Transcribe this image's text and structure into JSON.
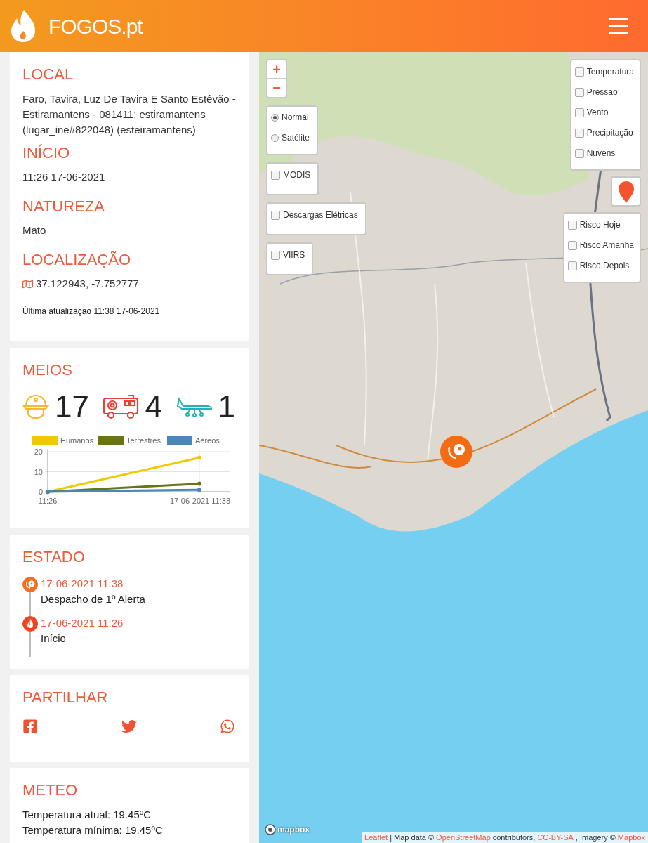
{
  "header": {
    "logo": "FOGOS.pt"
  },
  "sections": {
    "local": {
      "title": "LOCAL",
      "text": "Faro, Tavira, Luz De Tavira E Santo Estêvão - Estiramantens - 081411: estiramantens (lugar_ine#822048) (esteiramantens)"
    },
    "inicio": {
      "title": "INÍCIO",
      "text": "11:26 17-06-2021"
    },
    "natureza": {
      "title": "NATUREZA",
      "text": "Mato"
    },
    "localizacao": {
      "title": "LOCALIZAÇÃO",
      "coords": "37.122943, -7.752777"
    },
    "updated": "Última atualização 11:38 17-06-2021"
  },
  "meios": {
    "title": "MEIOS",
    "counts": [
      {
        "kind": "human",
        "value": "17",
        "color": "#f5b82e"
      },
      {
        "kind": "ground",
        "value": "4",
        "color": "#e8403a"
      },
      {
        "kind": "air",
        "value": "1",
        "color": "#1fb3b3"
      }
    ],
    "chart_data": {
      "type": "line",
      "legend": "top",
      "categories": [
        "11:26",
        "17-06-2021 11:38"
      ],
      "ylim": [
        0,
        20
      ],
      "yticks": [
        0,
        10,
        20
      ],
      "series": [
        {
          "name": "Humanos",
          "color": "#f0c800",
          "marker": "circle",
          "values": [
            0,
            17
          ]
        },
        {
          "name": "Terrestres",
          "color": "#6b7414",
          "marker": "circle",
          "values": [
            0,
            4
          ]
        },
        {
          "name": "Aéreos",
          "color": "#4a86b8",
          "marker": "circle",
          "values": [
            0,
            1
          ]
        }
      ]
    }
  },
  "estado": {
    "title": "ESTADO",
    "events": [
      {
        "kind": "dispatch",
        "date": "17-06-2021 11:38",
        "label": "Despacho de 1º Alerta"
      },
      {
        "kind": "start",
        "date": "17-06-2021 11:26",
        "label": "Início"
      }
    ]
  },
  "partilhar": {
    "title": "PARTILHAR",
    "links": [
      {
        "kind": "facebook"
      },
      {
        "kind": "twitter"
      },
      {
        "kind": "whatsapp"
      }
    ]
  },
  "meteo": {
    "title": "METEO",
    "lines": [
      "Temperatura atual: 19.45ºC",
      "Temperatura mínima: 19.45ºC"
    ]
  },
  "map": {
    "zoom": [
      "+",
      "−"
    ],
    "base_layers": [
      {
        "label": "Normal",
        "selected": true
      },
      {
        "label": "Satélite",
        "selected": false
      }
    ],
    "overlays": [
      {
        "label": "MODIS",
        "checked": false
      },
      {
        "label": "Descargas Elétricas",
        "checked": false
      },
      {
        "label": "VIIRS",
        "checked": false
      }
    ],
    "weather": [
      {
        "label": "Temperatura",
        "checked": false
      },
      {
        "label": "Pressão",
        "checked": false
      },
      {
        "label": "Vento",
        "checked": false
      },
      {
        "label": "Precipitação",
        "checked": false
      },
      {
        "label": "Nuvens",
        "checked": false
      }
    ],
    "risk": [
      {
        "label": "Risco Hoje",
        "checked": false
      },
      {
        "label": "Risco Amanhã",
        "checked": false
      },
      {
        "label": "Risco Depois",
        "checked": false
      }
    ],
    "logo": "mapbox",
    "attribution": [
      {
        "kind": "link",
        "text": "Leaflet"
      },
      {
        "kind": "text",
        "text": "| Map data ©"
      },
      {
        "kind": "link",
        "text": "OpenStreetMap"
      },
      {
        "kind": "text",
        "text": "contributors,"
      },
      {
        "kind": "link",
        "text": "CC-BY-SA"
      },
      {
        "kind": "text",
        "text": ", Imagery ©"
      },
      {
        "kind": "link",
        "text": "Mapbox"
      }
    ]
  }
}
